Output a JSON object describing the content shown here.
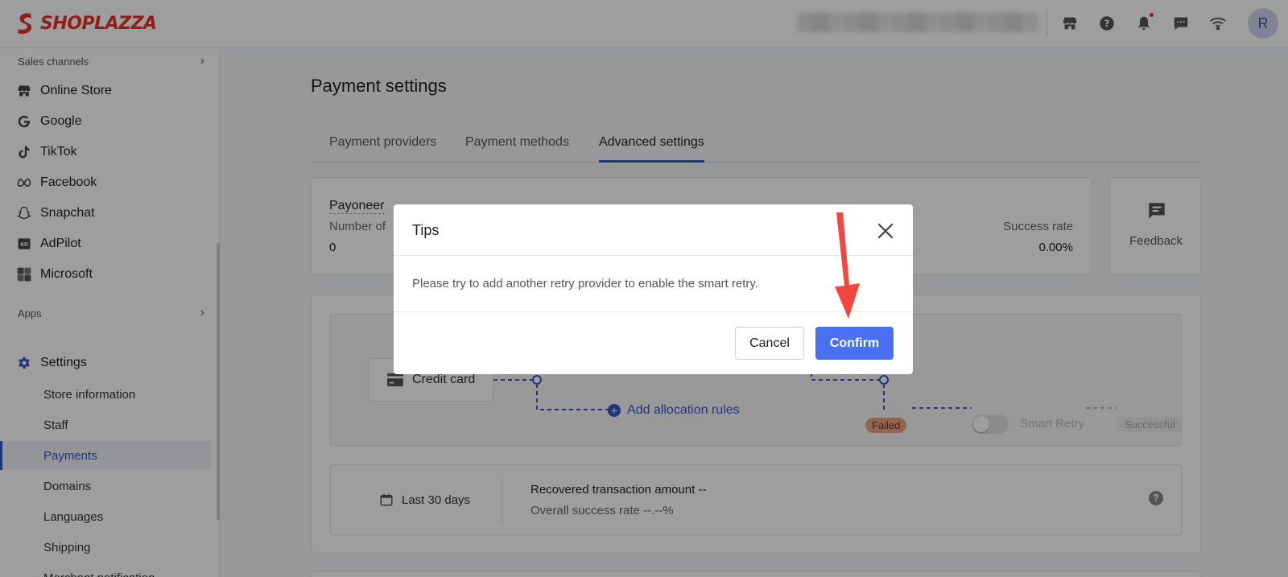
{
  "brand": {
    "name": "SHOPLAZZA",
    "color": "#e8312a"
  },
  "topbar": {
    "icons": [
      "store-icon",
      "help-icon",
      "bell-icon",
      "chat-icon",
      "wifi-icon"
    ],
    "avatar_initial": "R"
  },
  "sidebar": {
    "sales_channels_label": "Sales channels",
    "channels": [
      {
        "label": "Online Store",
        "icon": "store-icon"
      },
      {
        "label": "Google",
        "icon": "google-icon"
      },
      {
        "label": "TikTok",
        "icon": "tiktok-icon"
      },
      {
        "label": "Facebook",
        "icon": "meta-icon"
      },
      {
        "label": "Snapchat",
        "icon": "snapchat-icon"
      },
      {
        "label": "AdPilot",
        "icon": "adpilot-icon"
      },
      {
        "label": "Microsoft",
        "icon": "microsoft-icon"
      }
    ],
    "apps_label": "Apps",
    "settings_label": "Settings",
    "settings_items": [
      "Store information",
      "Staff",
      "Payments",
      "Domains",
      "Languages",
      "Shipping",
      "Merchant notification"
    ],
    "active_item": "Payments"
  },
  "main": {
    "title": "Payment settings",
    "tabs": [
      "Payment providers",
      "Payment methods",
      "Advanced settings"
    ],
    "active_tab": "Advanced settings",
    "stats": {
      "provider": "Payoneer",
      "number_label": "Number of",
      "number_value": "0",
      "success_label": "Success rate",
      "success_value": "0.00%"
    },
    "feedback_label": "Feedback",
    "flow": {
      "credit_card_label": "Credit card",
      "add_rules_label": "Add allocation rules",
      "failed_label": "Failed",
      "smart_retry_label": "Smart Retry",
      "successful_label": "Successful"
    },
    "summary": {
      "range_label": "Last 30 days",
      "recovered_label": "Recovered transaction amount --",
      "overall_label": "Overall success rate --.--%"
    }
  },
  "modal": {
    "title": "Tips",
    "body": "Please try to add another retry provider to enable the smart retry.",
    "cancel_label": "Cancel",
    "confirm_label": "Confirm",
    "confirm_color": "#4870f0",
    "arrow_color": "#f2473f"
  }
}
